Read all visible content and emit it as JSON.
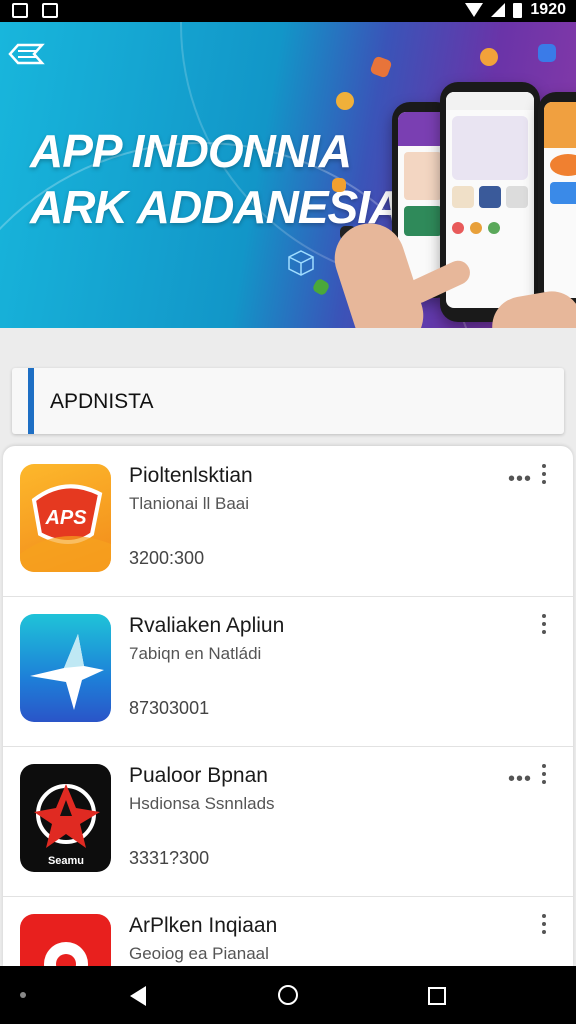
{
  "status_bar": {
    "time": "1920"
  },
  "banner": {
    "title_line1": "APP INDONNIA",
    "title_line2": "ARK ADDANESIA",
    "colors": {
      "start": "#18b6dc",
      "end": "#8a3aa8"
    }
  },
  "section": {
    "title": "APDNISTA",
    "accent": "#1e6fc4"
  },
  "apps": [
    {
      "name": "Pioltenlsktian",
      "subtitle": "Tlanionai ll Baai",
      "number": "3200:300",
      "icon": "aps-shield-icon",
      "menu": "both"
    },
    {
      "name": "Rvaliaken Apliun",
      "subtitle": "7abiqn en Natládi",
      "number": "87303001",
      "icon": "arrow-icon",
      "menu": "vertical"
    },
    {
      "name": "Pualoor Bpnan",
      "subtitle": "Hsdionsa Ssnnlads",
      "number": "3331?300",
      "icon": "star-logo-icon",
      "icon_label": "Seamu",
      "menu": "both"
    },
    {
      "name": "ArPlken Inqiaan",
      "subtitle": "Geoiog ea Pianaal",
      "number": "",
      "icon": "gear-icon",
      "menu": "vertical"
    }
  ],
  "nav": {
    "back": "back-icon",
    "home": "home-icon",
    "recent": "recents-icon"
  }
}
